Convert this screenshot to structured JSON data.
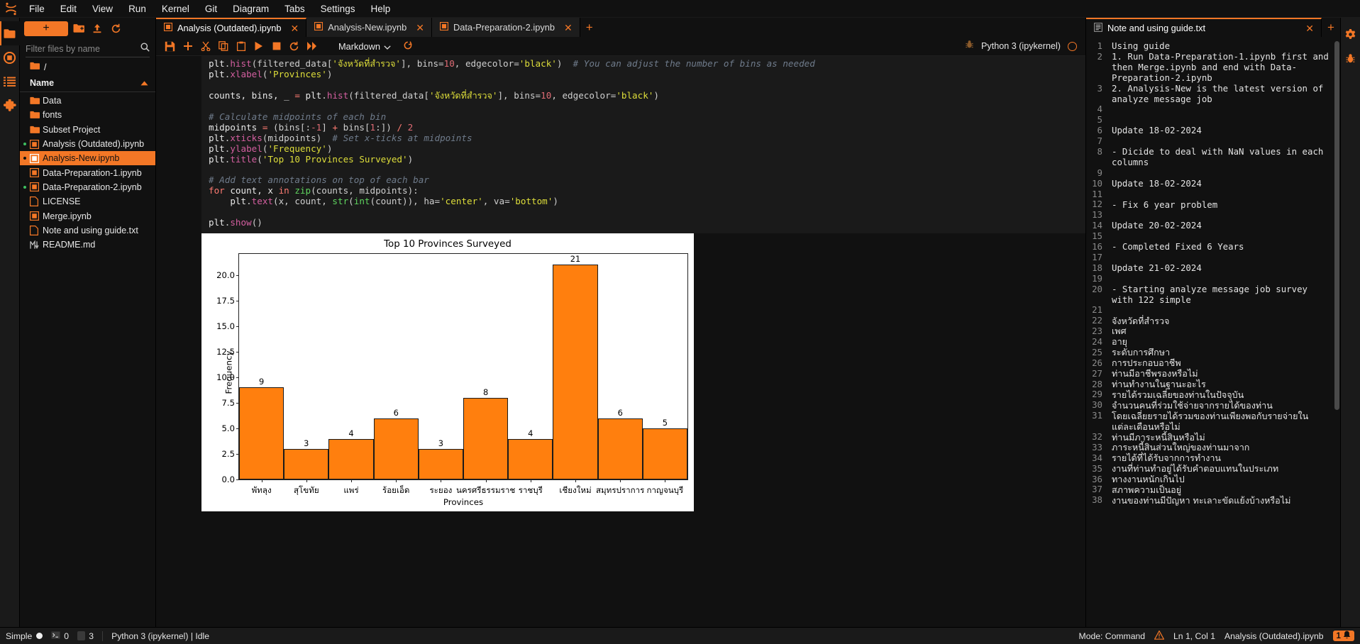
{
  "menubar": {
    "logo_icon": "jupyter-logo-icon",
    "items": [
      "File",
      "Edit",
      "View",
      "Run",
      "Kernel",
      "Git",
      "Diagram",
      "Tabs",
      "Settings",
      "Help"
    ]
  },
  "left_rail": {
    "items": [
      {
        "name": "file-browser-icon",
        "glyph": "folder"
      },
      {
        "name": "running-terminals-icon",
        "glyph": "stop-circle"
      },
      {
        "name": "table-of-contents-icon",
        "glyph": "list"
      },
      {
        "name": "extension-manager-icon",
        "glyph": "puzzle"
      }
    ]
  },
  "filebrowser": {
    "new_label": "+",
    "new_folder_icon": "new-folder-icon",
    "upload_icon": "upload-icon",
    "refresh_icon": "refresh-icon",
    "filter_placeholder": "Filter files by name",
    "filter_value": "",
    "search_icon": "search-icon",
    "breadcrumb": "/",
    "column_header": "Name",
    "sort_icon": "sort-ascending-icon",
    "items": [
      {
        "label": "Data",
        "type": "folder",
        "status": "",
        "selected": false
      },
      {
        "label": "fonts",
        "type": "folder",
        "status": "",
        "selected": false
      },
      {
        "label": "Subset Project",
        "type": "folder",
        "status": "",
        "selected": false
      },
      {
        "label": "Analysis (Outdated).ipynb",
        "type": "notebook",
        "status": "running",
        "selected": false
      },
      {
        "label": "Analysis-New.ipynb",
        "type": "notebook",
        "status": "running",
        "selected": true
      },
      {
        "label": "Data-Preparation-1.ipynb",
        "type": "notebook",
        "status": "",
        "selected": false
      },
      {
        "label": "Data-Preparation-2.ipynb",
        "type": "notebook",
        "status": "running",
        "selected": false
      },
      {
        "label": "LICENSE",
        "type": "file",
        "status": "",
        "selected": false
      },
      {
        "label": "Merge.ipynb",
        "type": "notebook",
        "status": "",
        "selected": false
      },
      {
        "label": "Note and using guide.txt",
        "type": "file",
        "status": "",
        "selected": false
      },
      {
        "label": "README.md",
        "type": "markdown",
        "status": "",
        "selected": false
      }
    ]
  },
  "center": {
    "tabs": [
      {
        "label": "Analysis (Outdated).ipynb",
        "icon": "notebook-icon",
        "active": true,
        "close_glyph": "✕"
      },
      {
        "label": "Analysis-New.ipynb",
        "icon": "notebook-icon",
        "active": false,
        "close_glyph": "✕"
      },
      {
        "label": "Data-Preparation-2.ipynb",
        "icon": "notebook-icon",
        "active": false,
        "close_glyph": "✕"
      }
    ],
    "tab_add_label": "+",
    "toolbar": {
      "save_icon": "save-icon",
      "insert_icon": "insert-cell-below-icon",
      "cut_icon": "cut-icon",
      "copy_icon": "copy-icon",
      "paste_icon": "paste-icon",
      "run_icon": "run-cell-icon",
      "stop_icon": "interrupt-kernel-icon",
      "restart_icon": "restart-kernel-icon",
      "restart_run_all_icon": "restart-and-run-all-icon",
      "celltype_value": "Markdown",
      "celltype_chevron": "chevron-down-icon",
      "git_icon": "git-branch-icon",
      "debugger_icon": "debugger-bug-icon",
      "kernel_name": "Python 3 (ipykernel)",
      "kernel_status_icon": "kernel-idle-circle-icon"
    },
    "cell": {
      "lines": [
        [
          {
            "t": "plt",
            "c": "o"
          },
          {
            "t": ".",
            "c": "p"
          },
          {
            "t": "hist",
            "c": "kw"
          },
          {
            "t": "(filtered_data[",
            "c": "p"
          },
          {
            "t": "'จังหวัดที่สำรวจ'",
            "c": "s"
          },
          {
            "t": "], bins=",
            "c": "p"
          },
          {
            "t": "10",
            "c": "n"
          },
          {
            "t": ", edgecolor=",
            "c": "p"
          },
          {
            "t": "'black'",
            "c": "s"
          },
          {
            "t": ")  ",
            "c": "p"
          },
          {
            "t": "# You can adjust the number of bins as needed",
            "c": "c"
          }
        ],
        [
          {
            "t": "plt",
            "c": "o"
          },
          {
            "t": ".",
            "c": "p"
          },
          {
            "t": "xlabel",
            "c": "kw"
          },
          {
            "t": "(",
            "c": "p"
          },
          {
            "t": "'Provinces'",
            "c": "s"
          },
          {
            "t": ")",
            "c": "p"
          }
        ],
        [],
        [
          {
            "t": "counts, bins, _ ",
            "c": "o"
          },
          {
            "t": "=",
            "c": "op"
          },
          {
            "t": " plt",
            "c": "o"
          },
          {
            "t": ".",
            "c": "p"
          },
          {
            "t": "hist",
            "c": "kw"
          },
          {
            "t": "(filtered_data[",
            "c": "p"
          },
          {
            "t": "'จังหวัดที่สำรวจ'",
            "c": "s"
          },
          {
            "t": "], bins=",
            "c": "p"
          },
          {
            "t": "10",
            "c": "n"
          },
          {
            "t": ", edgecolor=",
            "c": "p"
          },
          {
            "t": "'black'",
            "c": "s"
          },
          {
            "t": ")",
            "c": "p"
          }
        ],
        [],
        [
          {
            "t": "# Calculate midpoints of each bin",
            "c": "c"
          }
        ],
        [
          {
            "t": "midpoints ",
            "c": "o"
          },
          {
            "t": "=",
            "c": "op"
          },
          {
            "t": " (bins[:",
            "c": "p"
          },
          {
            "t": "-1",
            "c": "n"
          },
          {
            "t": "] ",
            "c": "p"
          },
          {
            "t": "+",
            "c": "op"
          },
          {
            "t": " bins[",
            "c": "p"
          },
          {
            "t": "1",
            "c": "n"
          },
          {
            "t": ":]) ",
            "c": "p"
          },
          {
            "t": "/",
            "c": "op"
          },
          {
            "t": " ",
            "c": "p"
          },
          {
            "t": "2",
            "c": "n"
          }
        ],
        [
          {
            "t": "plt",
            "c": "o"
          },
          {
            "t": ".",
            "c": "p"
          },
          {
            "t": "xticks",
            "c": "kw"
          },
          {
            "t": "(midpoints)  ",
            "c": "p"
          },
          {
            "t": "# Set x-ticks at midpoints",
            "c": "c"
          }
        ],
        [
          {
            "t": "plt",
            "c": "o"
          },
          {
            "t": ".",
            "c": "p"
          },
          {
            "t": "ylabel",
            "c": "kw"
          },
          {
            "t": "(",
            "c": "p"
          },
          {
            "t": "'Frequency'",
            "c": "s"
          },
          {
            "t": ")",
            "c": "p"
          }
        ],
        [
          {
            "t": "plt",
            "c": "o"
          },
          {
            "t": ".",
            "c": "p"
          },
          {
            "t": "title",
            "c": "kw"
          },
          {
            "t": "(",
            "c": "p"
          },
          {
            "t": "'Top 10 Provinces Surveyed'",
            "c": "s"
          },
          {
            "t": ")",
            "c": "p"
          }
        ],
        [],
        [
          {
            "t": "# Add text annotations on top of each bar",
            "c": "c"
          }
        ],
        [
          {
            "t": "for",
            "c": "k"
          },
          {
            "t": " count, x ",
            "c": "o"
          },
          {
            "t": "in",
            "c": "k"
          },
          {
            "t": " ",
            "c": "o"
          },
          {
            "t": "zip",
            "c": "f"
          },
          {
            "t": "(counts, midpoints):",
            "c": "p"
          }
        ],
        [
          {
            "t": "    plt",
            "c": "o"
          },
          {
            "t": ".",
            "c": "p"
          },
          {
            "t": "text",
            "c": "kw"
          },
          {
            "t": "(x, count, ",
            "c": "p"
          },
          {
            "t": "str",
            "c": "f"
          },
          {
            "t": "(",
            "c": "p"
          },
          {
            "t": "int",
            "c": "f"
          },
          {
            "t": "(count)), ha=",
            "c": "p"
          },
          {
            "t": "'center'",
            "c": "s"
          },
          {
            "t": ", va=",
            "c": "p"
          },
          {
            "t": "'bottom'",
            "c": "s"
          },
          {
            "t": ")",
            "c": "p"
          }
        ],
        [],
        [
          {
            "t": "plt",
            "c": "o"
          },
          {
            "t": ".",
            "c": "p"
          },
          {
            "t": "show",
            "c": "kw"
          },
          {
            "t": "()",
            "c": "p"
          }
        ]
      ]
    }
  },
  "chart_data": {
    "type": "bar",
    "title": "Top 10 Provinces Surveyed",
    "xlabel": "Provinces",
    "ylabel": "Frequency",
    "categories": [
      "พัทลุง",
      "สุโขทัย",
      "แพร่",
      "ร้อยเอ็ด",
      "ระยอง",
      "นครศรีธรรมราช",
      "ราชบุรี",
      "เชียงใหม่",
      "สมุทรปราการ",
      "กาญจนบุรี"
    ],
    "values": [
      9,
      3,
      4,
      6,
      3,
      8,
      4,
      21,
      6,
      5
    ],
    "ytick_labels": [
      "0.0",
      "2.5",
      "5.0",
      "7.5",
      "10.0",
      "12.5",
      "15.0",
      "17.5",
      "20.0"
    ],
    "ytick_values": [
      0,
      2.5,
      5,
      7.5,
      10,
      12.5,
      15,
      17.5,
      20
    ],
    "ylim": [
      0,
      22.05
    ],
    "grid": false,
    "legend": null,
    "bar_color": "#ff7f0e",
    "bar_edge_color": "#1a1a1a"
  },
  "right_panel": {
    "tabs": [
      {
        "label": "Note and using guide.txt",
        "icon": "text-file-icon",
        "active": true,
        "close_glyph": "✕"
      }
    ],
    "tab_add_label": "+",
    "lines": [
      {
        "no": "1",
        "text": "Using guide",
        "thai": false
      },
      {
        "no": "2",
        "text": "1. Run Data-Preparation-1.ipynb first and then Merge.ipynb and end with Data-Preparation-2.ipynb",
        "thai": false
      },
      {
        "no": "3",
        "text": "2. Analysis-New is the latest version of analyze message job",
        "thai": false
      },
      {
        "no": "4",
        "text": "",
        "thai": false
      },
      {
        "no": "5",
        "text": "",
        "thai": false
      },
      {
        "no": "6",
        "text": "Update 18-02-2024",
        "thai": false
      },
      {
        "no": "7",
        "text": "",
        "thai": false
      },
      {
        "no": "8",
        "text": "- Dicide to deal with NaN values in each columns",
        "thai": false
      },
      {
        "no": "9",
        "text": "",
        "thai": false
      },
      {
        "no": "10",
        "text": "Update 18-02-2024",
        "thai": false
      },
      {
        "no": "11",
        "text": "",
        "thai": false
      },
      {
        "no": "12",
        "text": "- Fix 6 year problem",
        "thai": false
      },
      {
        "no": "13",
        "text": "",
        "thai": false
      },
      {
        "no": "14",
        "text": "Update 20-02-2024",
        "thai": false
      },
      {
        "no": "15",
        "text": "",
        "thai": false
      },
      {
        "no": "16",
        "text": "- Completed Fixed 6 Years",
        "thai": false
      },
      {
        "no": "17",
        "text": "",
        "thai": false
      },
      {
        "no": "18",
        "text": "Update 21-02-2024",
        "thai": false
      },
      {
        "no": "19",
        "text": "",
        "thai": false
      },
      {
        "no": "20",
        "text": "- Starting analyze message job survey with 122 simple",
        "thai": false
      },
      {
        "no": "21",
        "text": "",
        "thai": false
      },
      {
        "no": "22",
        "text": "จังหวัดที่สำรวจ",
        "thai": true
      },
      {
        "no": "23",
        "text": "เพศ",
        "thai": true
      },
      {
        "no": "24",
        "text": "อายุ",
        "thai": true
      },
      {
        "no": "25",
        "text": "ระดับการศึกษา",
        "thai": true
      },
      {
        "no": "26",
        "text": "การประกอบอาชีพ",
        "thai": true
      },
      {
        "no": "27",
        "text": "ท่านมีอาชีพรองหรือไม่",
        "thai": true
      },
      {
        "no": "28",
        "text": "ท่านทำงานในฐานะอะไร",
        "thai": true
      },
      {
        "no": "29",
        "text": "รายได้รวมเฉลี่ยของท่านในปัจจุบัน",
        "thai": true
      },
      {
        "no": "30",
        "text": "จำนวนคนที่ร่วมใช้จ่ายจากรายได้ของท่าน",
        "thai": true
      },
      {
        "no": "31",
        "text": "โดยเฉลี่ยยรายได้รวมของท่านเพียงพอกับรายจ่ายในแต่ละเดือนหรือไม่",
        "thai": true
      },
      {
        "no": "32",
        "text": "ท่านมีภาระหนี้สินหรือไม่",
        "thai": true
      },
      {
        "no": "33",
        "text": "ภาระหนี้สินส่วนใหญ่ของท่านมาจาก",
        "thai": true
      },
      {
        "no": "34",
        "text": "รายได้ที่ได้รับจากการทำงาน",
        "thai": true
      },
      {
        "no": "35",
        "text": "งานที่ท่านทำอยู่ได้รับคำตอบแทนในประเภท",
        "thai": true
      },
      {
        "no": "36",
        "text": "ทางงานหนักเกินไป",
        "thai": true
      },
      {
        "no": "37",
        "text": "สภาพความเป็นอยู่",
        "thai": true
      },
      {
        "no": "38",
        "text": "งานของท่านมีปัญหา ทะเลาะขัดแย้งบ้างหรือไม่",
        "thai": true
      }
    ]
  },
  "right_rail": {
    "items": [
      {
        "name": "property-inspector-icon",
        "glyph": "gear"
      },
      {
        "name": "debugger-icon",
        "glyph": "bug"
      }
    ]
  },
  "statusbar": {
    "mode_label": "Simple",
    "terminals_count": "0",
    "kernels_count": "3",
    "kernel_status": "Python 3 (ipykernel) | Idle",
    "editor_mode": "Mode: Command",
    "cursor_position": "Ln 1, Col 1",
    "active_file": "Analysis (Outdated).ipynb",
    "notification_count": "1",
    "notification_icon": "bell-icon",
    "warning_icon": "warning-icon"
  },
  "colors": {
    "accent": "#f37726",
    "background": "#111111",
    "panel": "#1a1a1a",
    "bar": "#ff7f0e",
    "running": "#3fbf5f"
  }
}
